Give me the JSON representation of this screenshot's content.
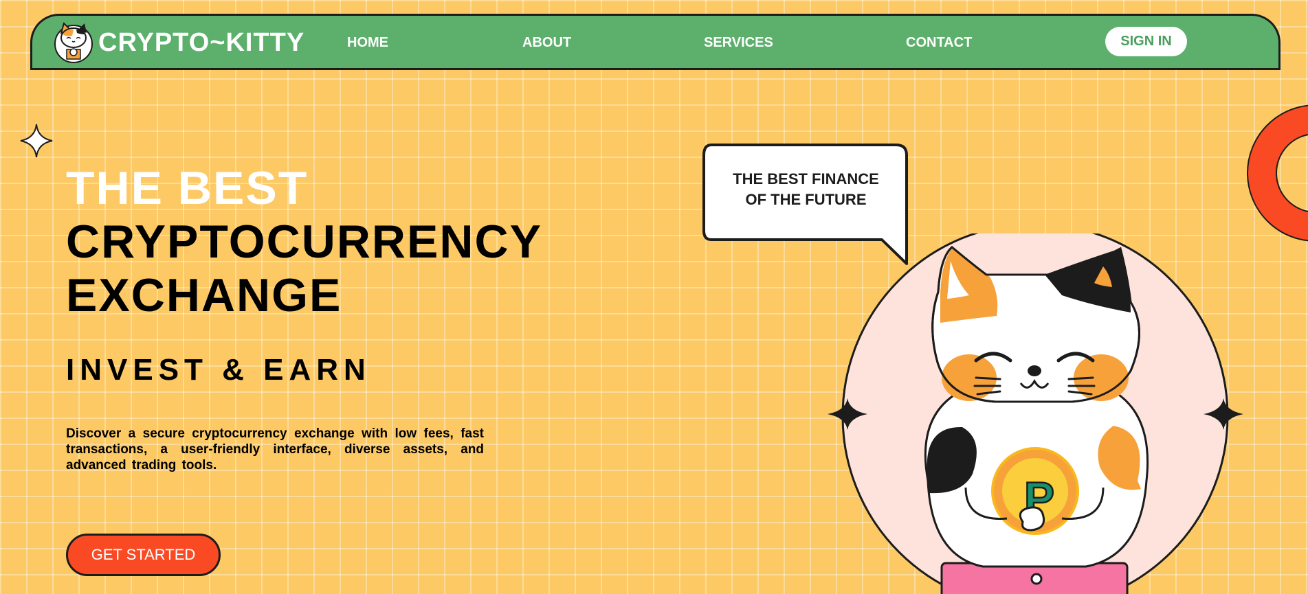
{
  "brand": {
    "name": "CRYPTO~KITTY"
  },
  "nav": {
    "items": [
      {
        "label": "HOME"
      },
      {
        "label": "ABOUT"
      },
      {
        "label": "SERVICES"
      },
      {
        "label": "CONTACT"
      }
    ],
    "signin_label": "SIGN IN"
  },
  "hero": {
    "line1": "THE BEST",
    "line2": "CRYPTOCURRENCY",
    "line3": "EXCHANGE",
    "subtitle": "INVEST & EARN",
    "description": "Discover a secure cryptocurrency exchange with low fees, fast transactions, a user-friendly interface, diverse assets, and advanced trading tools.",
    "cta_label": "GET STARTED"
  },
  "bubble": {
    "line1": "THE BEST FINANCE",
    "line2": "OF THE FUTURE"
  },
  "coin": {
    "letter": "P"
  },
  "colors": {
    "background": "#fcc964",
    "nav_green": "#5cb06c",
    "cta_red": "#fa4a23",
    "ring_red": "#fa4a23",
    "circle_pink": "#fde3dc"
  },
  "icons": [
    "cat-logo-icon",
    "sparkle-icon",
    "coin-icon"
  ]
}
